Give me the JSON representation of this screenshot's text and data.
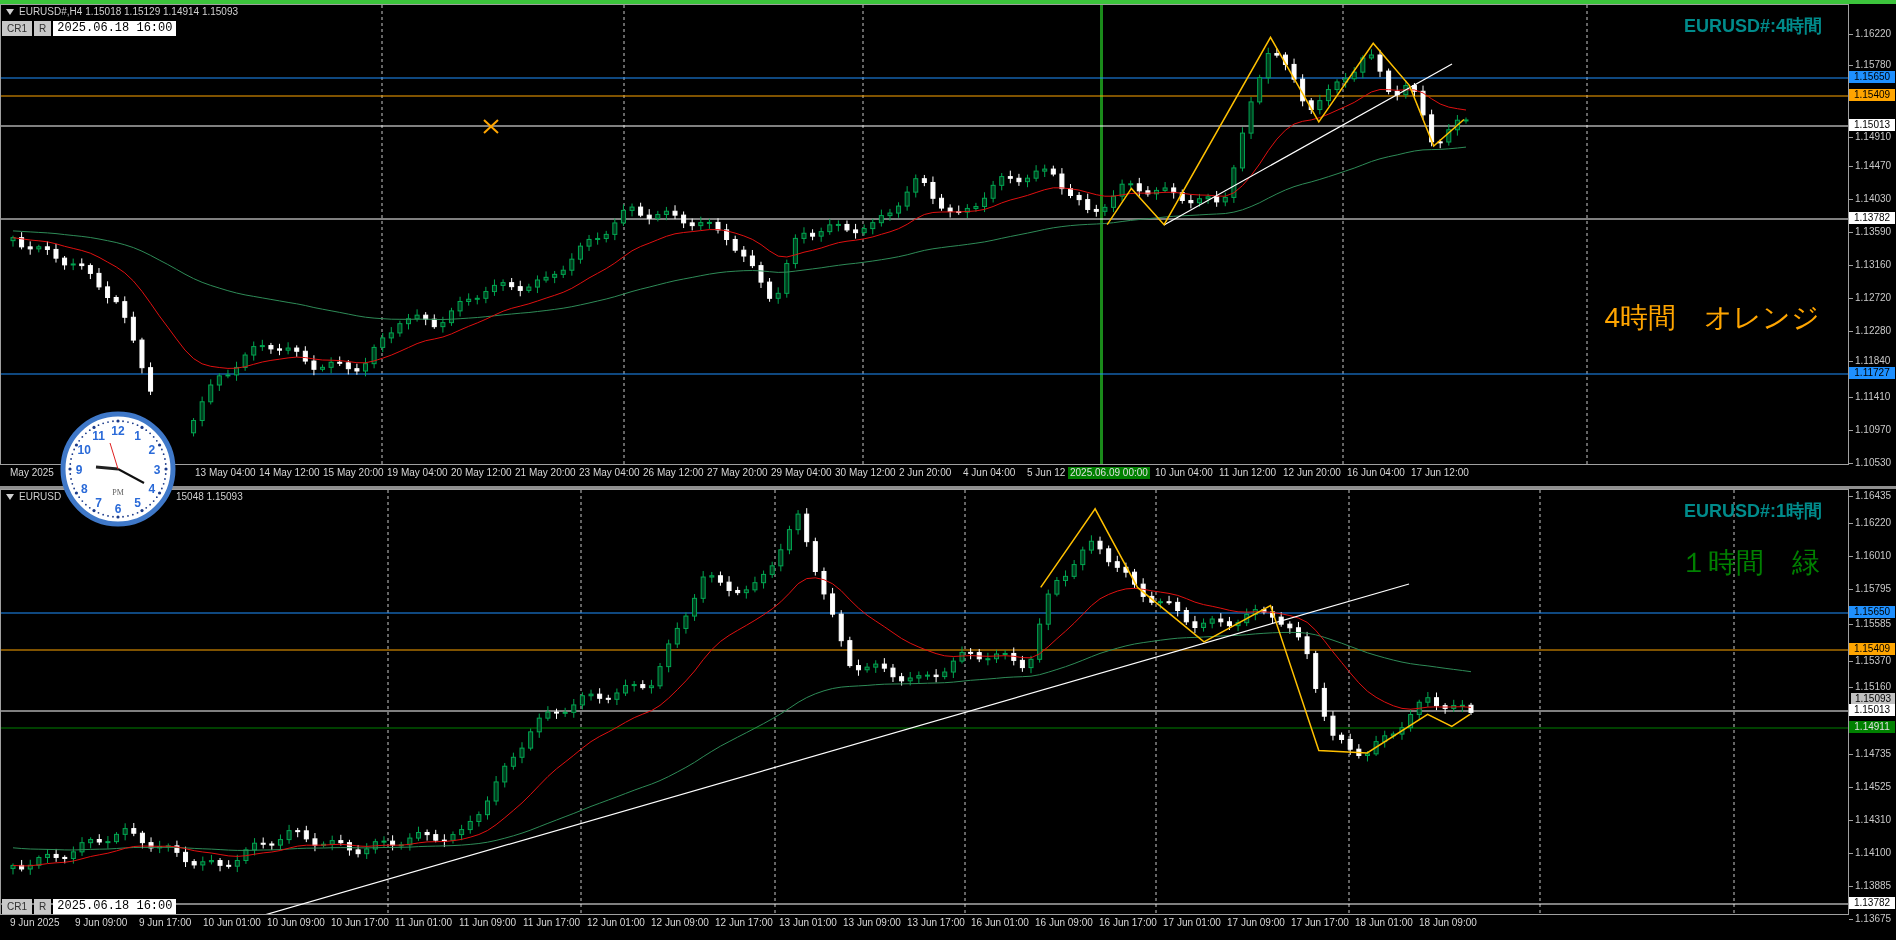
{
  "charts": [
    {
      "header": [
        "EURUSD#,H4 1.15018 1.15129 1.14914 1.15093"
      ],
      "buttons": [
        "CR1",
        "R"
      ],
      "date_field": "2025.06.18 16:00",
      "title": "EURUSD#:4時間",
      "note": {
        "text": "4時間　オレンジ",
        "color": "#ffa500"
      },
      "price_ticks": [
        "1.16220",
        "1.15780",
        "1.14910",
        "1.14470",
        "1.14030",
        "1.13590",
        "1.13160",
        "1.12720",
        "1.12280",
        "1.11840",
        "1.11410",
        "1.10970",
        "1.10530"
      ],
      "price_lines": [
        {
          "price": "1.15650",
          "color": "#1e90ff",
          "kind": "line"
        },
        {
          "price": "1.15409",
          "color": "#ffa500",
          "kind": "line"
        },
        {
          "price": "1.15013",
          "color": "#ffffff",
          "kind": "line"
        },
        {
          "price": "1.13782",
          "color": "#ffffff",
          "kind": "line"
        },
        {
          "price": "1.11727",
          "color": "#1e90ff",
          "kind": "line"
        }
      ],
      "time_labels": [
        "May 2025",
        "13 May 04:00",
        "14 May 12:00",
        "15 May 20:00",
        "19 May 04:00",
        "20 May 12:00",
        "21 May 20:00",
        "23 May 04:00",
        "26 May 12:00",
        "27 May 20:00",
        "29 May 04:00",
        "30 May 12:00",
        "2 Jun 20:00",
        "4 Jun 04:00",
        "5 Jun 12",
        "10 Jun 04:00",
        "11 Jun 12:00",
        "12 Jun 20:00",
        "16 Jun 04:00",
        "17 Jun 12:00"
      ],
      "highlighted_time": "2025.06.09 00:00"
    },
    {
      "header": [
        "EURUSD",
        "15048 1.15093"
      ],
      "buttons": [
        "CR1",
        "R"
      ],
      "date_field": "2025.06.18 16:00",
      "title": "EURUSD#:1時間",
      "note": {
        "text": "１時間　緑",
        "color": "#008000"
      },
      "price_ticks": [
        "1.16435",
        "1.16220",
        "1.16010",
        "1.15795",
        "1.15585",
        "1.15370",
        "1.15160",
        "1.14735",
        "1.14525",
        "1.14310",
        "1.14100",
        "1.13885",
        "1.13675"
      ],
      "price_lines": [
        {
          "price": "1.15650",
          "color": "#1e90ff",
          "kind": "line"
        },
        {
          "price": "1.15409",
          "color": "#ffa500",
          "kind": "line"
        },
        {
          "price": "1.15093",
          "color": "#c0c0c0",
          "kind": "tag"
        },
        {
          "price": "1.15013",
          "color": "#ffffff",
          "kind": "line"
        },
        {
          "price": "1.14911",
          "color": "#008000",
          "kind": "line"
        },
        {
          "price": "1.13782",
          "color": "#ffffff",
          "kind": "line"
        }
      ],
      "time_labels": [
        "9 Jun 2025",
        "9 Jun 09:00",
        "9 Jun 17:00",
        "10 Jun 01:00",
        "10 Jun 09:00",
        "10 Jun 17:00",
        "11 Jun 01:00",
        "11 Jun 09:00",
        "11 Jun 17:00",
        "12 Jun 01:00",
        "12 Jun 09:00",
        "12 Jun 17:00",
        "13 Jun 01:00",
        "13 Jun 09:00",
        "13 Jun 17:00",
        "16 Jun 01:00",
        "16 Jun 09:00",
        "16 Jun 17:00",
        "17 Jun 01:00",
        "17 Jun 09:00",
        "17 Jun 17:00",
        "18 Jun 01:00",
        "18 Jun 09:00"
      ]
    }
  ],
  "clock": {
    "numerals": [
      "12",
      "11",
      "1",
      "10",
      "2",
      "9",
      "3",
      "8",
      "4",
      "7",
      "5",
      "6"
    ],
    "period": "PM"
  }
}
